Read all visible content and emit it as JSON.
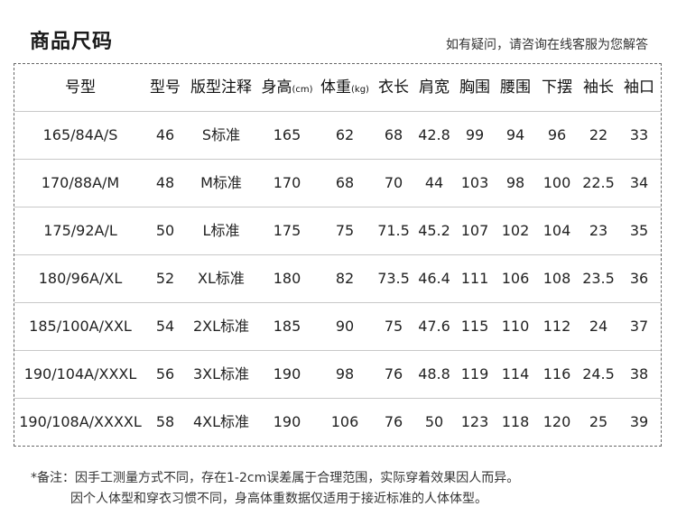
{
  "header": {
    "title": "商品尺码",
    "contact": "如有疑问，请咨询在线客服为您解答"
  },
  "table": {
    "columns": [
      {
        "label": "号型",
        "unit": ""
      },
      {
        "label": "型号",
        "unit": ""
      },
      {
        "label": "版型注释",
        "unit": ""
      },
      {
        "label": "身高",
        "unit": "(cm)"
      },
      {
        "label": "体重",
        "unit": "(kg)"
      },
      {
        "label": "衣长",
        "unit": ""
      },
      {
        "label": "肩宽",
        "unit": ""
      },
      {
        "label": "胸围",
        "unit": ""
      },
      {
        "label": "腰围",
        "unit": ""
      },
      {
        "label": "下摆",
        "unit": ""
      },
      {
        "label": "袖长",
        "unit": ""
      },
      {
        "label": "袖口",
        "unit": ""
      }
    ],
    "rows": [
      [
        "165/84A/S",
        "46",
        "S标准",
        "165",
        "62",
        "68",
        "42.8",
        "99",
        "94",
        "96",
        "22",
        "33"
      ],
      [
        "170/88A/M",
        "48",
        "M标准",
        "170",
        "68",
        "70",
        "44",
        "103",
        "98",
        "100",
        "22.5",
        "34"
      ],
      [
        "175/92A/L",
        "50",
        "L标准",
        "175",
        "75",
        "71.5",
        "45.2",
        "107",
        "102",
        "104",
        "23",
        "35"
      ],
      [
        "180/96A/XL",
        "52",
        "XL标准",
        "180",
        "82",
        "73.5",
        "46.4",
        "111",
        "106",
        "108",
        "23.5",
        "36"
      ],
      [
        "185/100A/XXL",
        "54",
        "2XL标准",
        "185",
        "90",
        "75",
        "47.6",
        "115",
        "110",
        "112",
        "24",
        "37"
      ],
      [
        "190/104A/XXXL",
        "56",
        "3XL标准",
        "190",
        "98",
        "76",
        "48.8",
        "119",
        "114",
        "116",
        "24.5",
        "38"
      ],
      [
        "190/108A/XXXXL",
        "58",
        "4XL标准",
        "190",
        "106",
        "76",
        "50",
        "123",
        "118",
        "120",
        "25",
        "39"
      ]
    ]
  },
  "notes": {
    "line1": "*备注：因手工测量方式不同，存在1-2cm误差属于合理范围，实际穿着效果因人而异。",
    "line2": "因个人体型和穿衣习惯不同，身高体重数据仅适用于接近标准的人体体型。"
  }
}
